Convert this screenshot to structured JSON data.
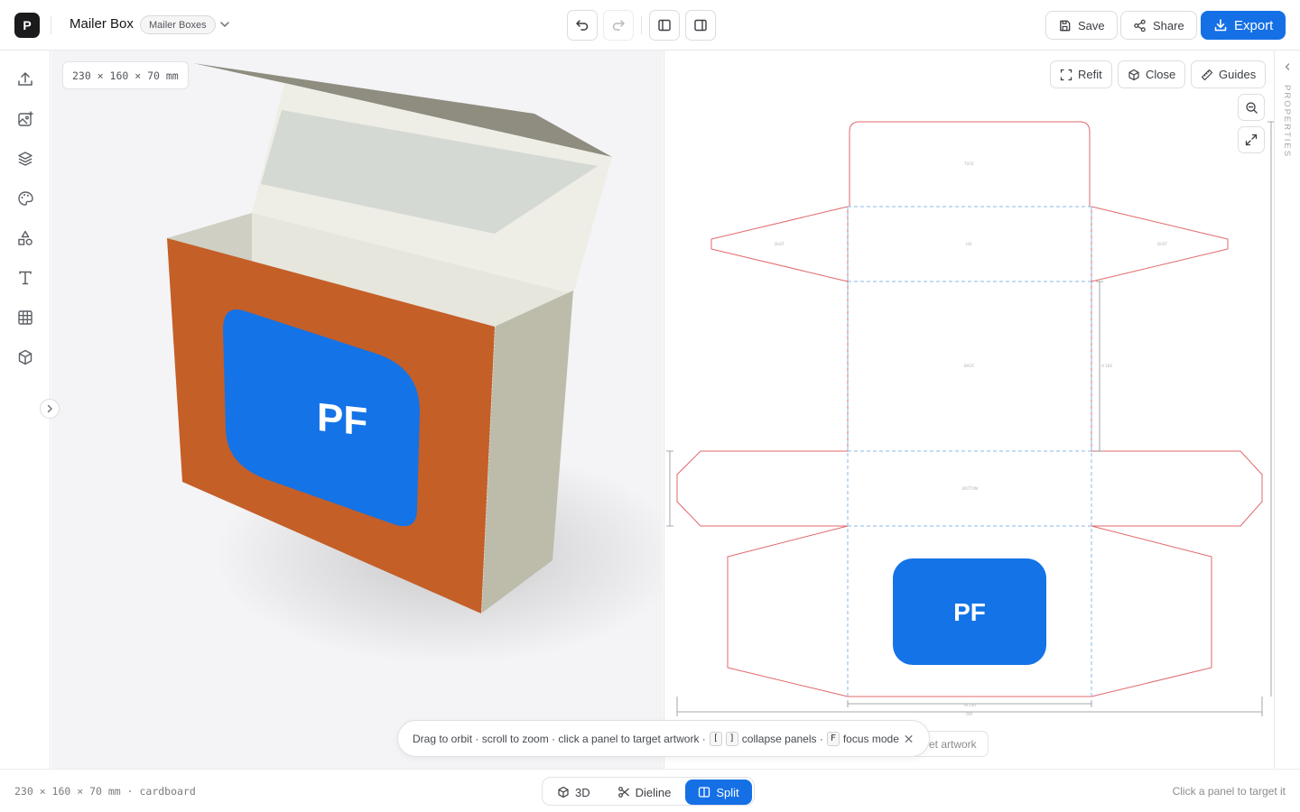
{
  "app": {
    "logo_letter": "P",
    "title": "Mailer Box",
    "category_badge": "Mailer Boxes"
  },
  "toolbar": {
    "undo_icon": "undo-icon",
    "redo_icon": "redo-icon",
    "left_panel_icon": "panel-left-icon",
    "right_panel_icon": "panel-right-icon",
    "save_label": "Save",
    "share_label": "Share",
    "export_label": "Export",
    "accent_color": "#1570e6"
  },
  "rail": {
    "items": [
      "upload-icon",
      "image-add-icon",
      "layers-icon",
      "palette-icon",
      "shapes-icon",
      "text-icon",
      "grid-icon",
      "cube-icon"
    ]
  },
  "view3d": {
    "dimensions": "230 × 160 × 70 mm",
    "box_color": "#c45f28",
    "artwork_color": "#1473e6",
    "artwork_text": "PF"
  },
  "dieline": {
    "refit_label": "Refit",
    "close_label": "Close",
    "guides_label": "Guides",
    "artwork_text": "PF",
    "ghost_chip_text": "et artwork",
    "cut_color": "#e0686b",
    "fold_color": "#8ab8e6"
  },
  "properties": {
    "label": "PROPERTIES"
  },
  "hint": {
    "part1": "Drag to orbit · scroll to zoom · click a panel to target artwork ·",
    "key1": "[",
    "key2": "]",
    "part2": "collapse panels ·",
    "key3": "F",
    "part3": "focus mode"
  },
  "bottombar": {
    "status_left": "230 × 160 × 70 mm · cardboard",
    "status_right": "Click a panel to target it",
    "view_modes": [
      "3D",
      "Dieline",
      "Split"
    ],
    "active_mode": "Split"
  }
}
